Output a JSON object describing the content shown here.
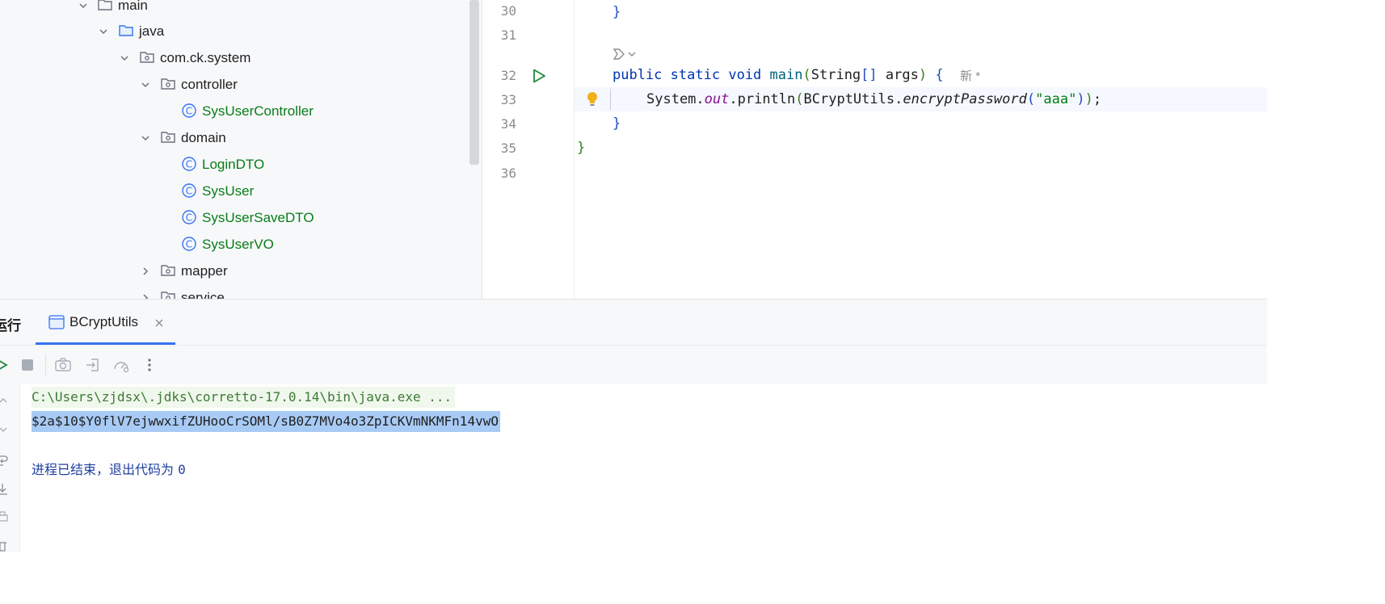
{
  "project_tree": {
    "items": [
      {
        "label": "main",
        "kind": "folder",
        "expanded": true
      },
      {
        "label": "java",
        "kind": "source-folder",
        "expanded": true
      },
      {
        "label": "com.ck.system",
        "kind": "package",
        "expanded": true
      },
      {
        "label": "controller",
        "kind": "package",
        "expanded": true
      },
      {
        "label": "SysUserController",
        "kind": "class"
      },
      {
        "label": "domain",
        "kind": "package",
        "expanded": true
      },
      {
        "label": "LoginDTO",
        "kind": "class"
      },
      {
        "label": "SysUser",
        "kind": "class"
      },
      {
        "label": "SysUserSaveDTO",
        "kind": "class"
      },
      {
        "label": "SysUserVO",
        "kind": "class"
      },
      {
        "label": "mapper",
        "kind": "package",
        "expanded": false
      },
      {
        "label": "service",
        "kind": "package",
        "expanded": false
      }
    ]
  },
  "editor": {
    "line_numbers": [
      "30",
      "31",
      "32",
      "33",
      "34",
      "35",
      "36"
    ],
    "current_line": "33",
    "code": {
      "l30": "}",
      "l32_kw1": "public",
      "l32_kw2": "static",
      "l32_kw3": "void",
      "l32_fn": "main",
      "l32_p_open": "(",
      "l32_type": "String",
      "l32_arr": "[]",
      "l32_arg": " args",
      "l32_p_close": ")",
      "l32_brace": " {",
      "l32_hint": "新 *",
      "l33_recv": "System.",
      "l33_field": "out",
      "l33_call": ".println",
      "l33_open": "(",
      "l33_cls": "BCryptUtils.",
      "l33_method": "encryptPassword",
      "l33_open2": "(",
      "l33_str": "\"aaa\"",
      "l33_close2": ")",
      "l33_close": ")",
      "l33_semi": ";",
      "l34": "}",
      "l35": "}"
    }
  },
  "tool_window": {
    "title": "运行",
    "tab_label": "BCryptUtils",
    "console": {
      "command": "C:\\Users\\zjdsx\\.jdks\\corretto-17.0.14\\bin\\java.exe ...",
      "output": "$2a$10$Y0flV7ejwwxifZUHooCrSOMl/sB0Z7MVo4o3ZpICKVmNKMFn14vwO",
      "exit_text": "进程已结束，退出代码为 ",
      "exit_code": "0"
    }
  },
  "colors": {
    "accent": "#3574f0",
    "class_name": "#067d17",
    "keyword": "#0033b3",
    "selection": "#a8cbf5"
  }
}
